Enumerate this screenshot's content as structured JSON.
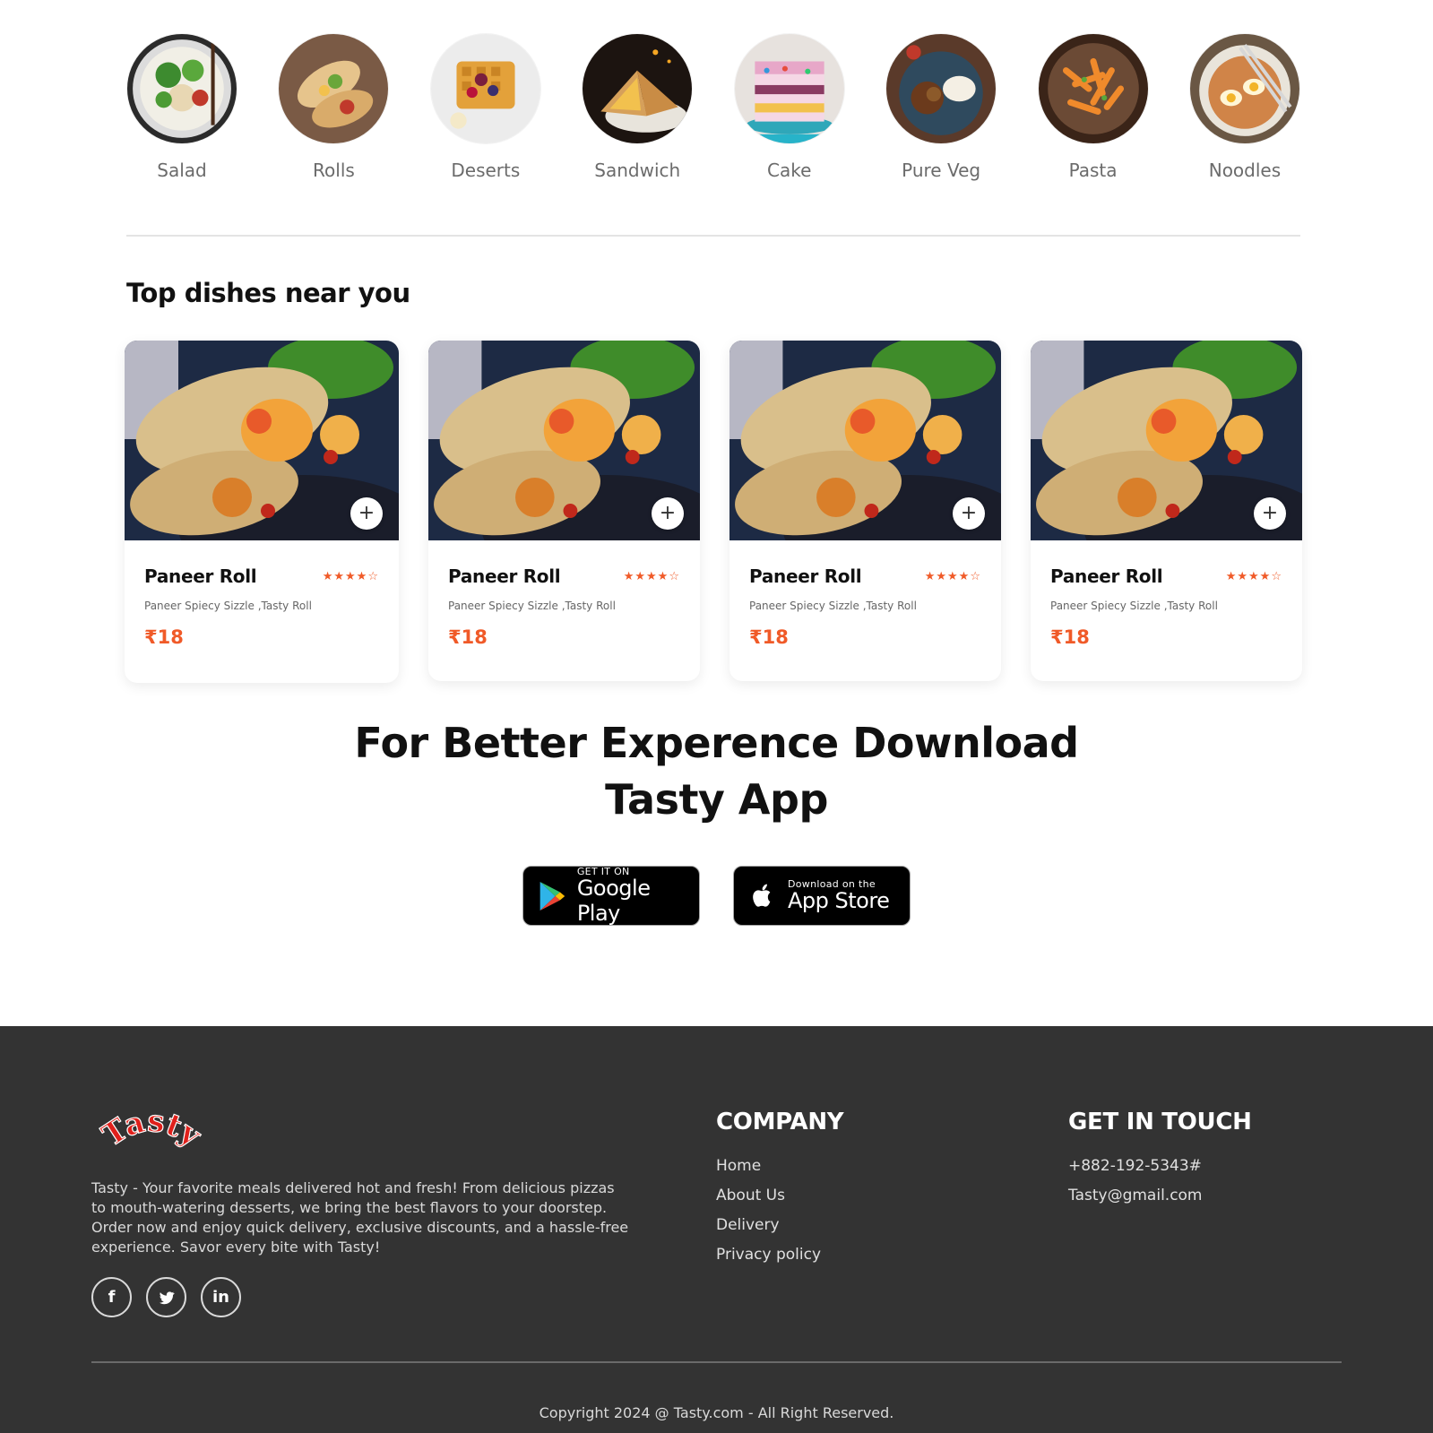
{
  "categories": [
    {
      "label": "Salad",
      "icon": "salad-image"
    },
    {
      "label": "Rolls",
      "icon": "rolls-image"
    },
    {
      "label": "Deserts",
      "icon": "deserts-image"
    },
    {
      "label": "Sandwich",
      "icon": "sandwich-image"
    },
    {
      "label": "Cake",
      "icon": "cake-image"
    },
    {
      "label": "Pure Veg",
      "icon": "pure-veg-image"
    },
    {
      "label": "Pasta",
      "icon": "pasta-image"
    },
    {
      "label": "Noodles",
      "icon": "noodles-image"
    }
  ],
  "top_dishes": {
    "title": "Top dishes near you",
    "items": [
      {
        "name": "Paneer Roll",
        "rating_stars": "★★★★☆",
        "rating": 4,
        "description": "Paneer Spiecy Sizzle ,Tasty Roll",
        "price": "₹18",
        "add": "+"
      },
      {
        "name": "Paneer Roll",
        "rating_stars": "★★★★☆",
        "rating": 4,
        "description": "Paneer Spiecy Sizzle ,Tasty Roll",
        "price": "₹18",
        "add": "+"
      },
      {
        "name": "Paneer Roll",
        "rating_stars": "★★★★☆",
        "rating": 4,
        "description": "Paneer Spiecy Sizzle ,Tasty Roll",
        "price": "₹18",
        "add": "+"
      },
      {
        "name": "Paneer Roll",
        "rating_stars": "★★★★☆",
        "rating": 4,
        "description": "Paneer Spiecy Sizzle ,Tasty Roll",
        "price": "₹18",
        "add": "+"
      }
    ]
  },
  "download": {
    "title_line1": "For Better Experence Download",
    "title_line2": "Tasty App",
    "google_play": {
      "small": "GET IT ON",
      "big": "Google Play"
    },
    "app_store": {
      "small": "Download on the",
      "big": "App Store"
    }
  },
  "footer": {
    "logo_text": "Tasty",
    "about": "Tasty - Your favorite meals delivered hot and fresh! From delicious pizzas to mouth-watering desserts, we bring the best flavors to your doorstep. Order now and enjoy quick delivery, exclusive discounts, and a hassle-free experience. Savor every bite with Tasty!",
    "socials": [
      "facebook-icon",
      "twitter-icon",
      "linkedin-icon"
    ],
    "company": {
      "title": "COMPANY",
      "links": [
        "Home",
        "About Us",
        "Delivery",
        "Privacy policy"
      ]
    },
    "contact": {
      "title": "GET IN TOUCH",
      "phone": "+882-192-5343#",
      "email": "Tasty@gmail.com"
    },
    "copyright": "Copyright 2024 @ Tasty.com - All Right Reserved."
  },
  "colors": {
    "accent": "#f05a28",
    "footer_bg": "#333333",
    "logo": "#e0201b"
  }
}
